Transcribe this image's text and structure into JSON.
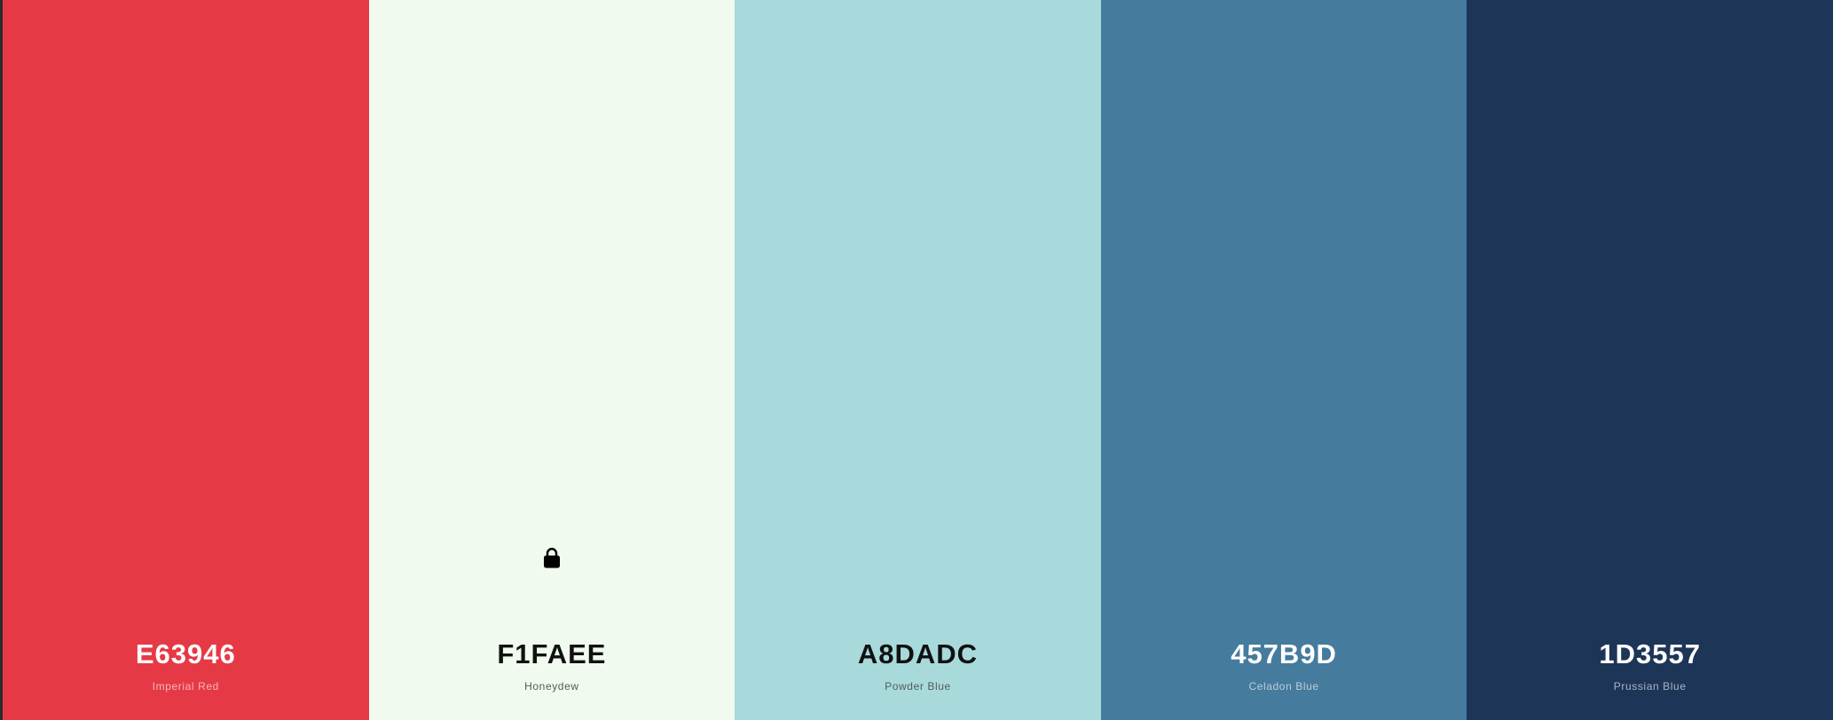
{
  "palette": {
    "colors": [
      {
        "hex_label": "E63946",
        "name": "Imperial Red",
        "color": "#E63946",
        "tone": "dark",
        "locked": false
      },
      {
        "hex_label": "F1FAEE",
        "name": "Honeydew",
        "color": "#F1FAEE",
        "tone": "light",
        "locked": true
      },
      {
        "hex_label": "A8DADC",
        "name": "Powder Blue",
        "color": "#A8DADC",
        "tone": "light",
        "locked": false
      },
      {
        "hex_label": "457B9D",
        "name": "Celadon Blue",
        "color": "#457B9D",
        "tone": "dark",
        "locked": false
      },
      {
        "hex_label": "1D3557",
        "name": "Prussian Blue",
        "color": "#1D3557",
        "tone": "dark",
        "locked": false
      }
    ],
    "lock_icon": "lock-icon"
  }
}
